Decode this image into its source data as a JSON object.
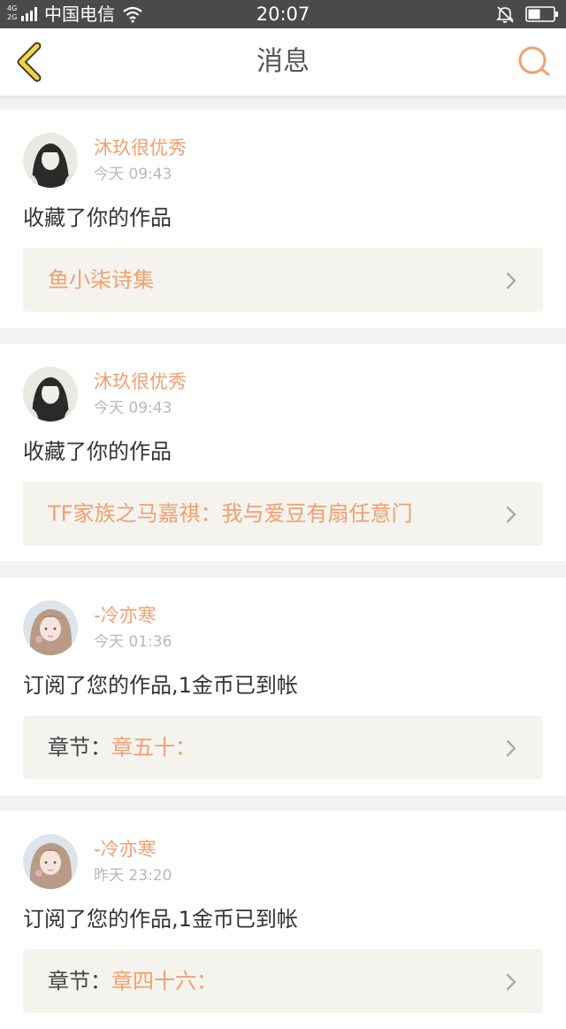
{
  "status_bar": {
    "network_top": "4G",
    "network_bottom": "2G",
    "carrier": "中国电信",
    "time": "20:07"
  },
  "header": {
    "title": "消息",
    "back_icon": "chevron-left-icon",
    "search_icon": "search-icon"
  },
  "colors": {
    "accent": "#f0a070",
    "back_icon": "#f5d53b",
    "card_link_bg": "#f4f3ee",
    "page_bg": "#f2f2f2"
  },
  "messages": [
    {
      "username": "沐玖很优秀",
      "time": "今天 09:43",
      "action": "收藏了你的作品",
      "work_prefix": "",
      "work_title": "鱼小柒诗集"
    },
    {
      "username": "沐玖很优秀",
      "time": "今天 09:43",
      "action": "收藏了你的作品",
      "work_prefix": "",
      "work_title": "TF家族之马嘉祺：我与爱豆有扇任意门"
    },
    {
      "username": "-冷亦寒",
      "time": "今天 01:36",
      "action": "订阅了您的作品,1金币已到帐",
      "work_prefix": "章节：",
      "work_title": "章五十："
    },
    {
      "username": "-冷亦寒",
      "time": "昨天 23:20",
      "action": "订阅了您的作品,1金币已到帐",
      "work_prefix": "章节：",
      "work_title": "章四十六："
    }
  ]
}
